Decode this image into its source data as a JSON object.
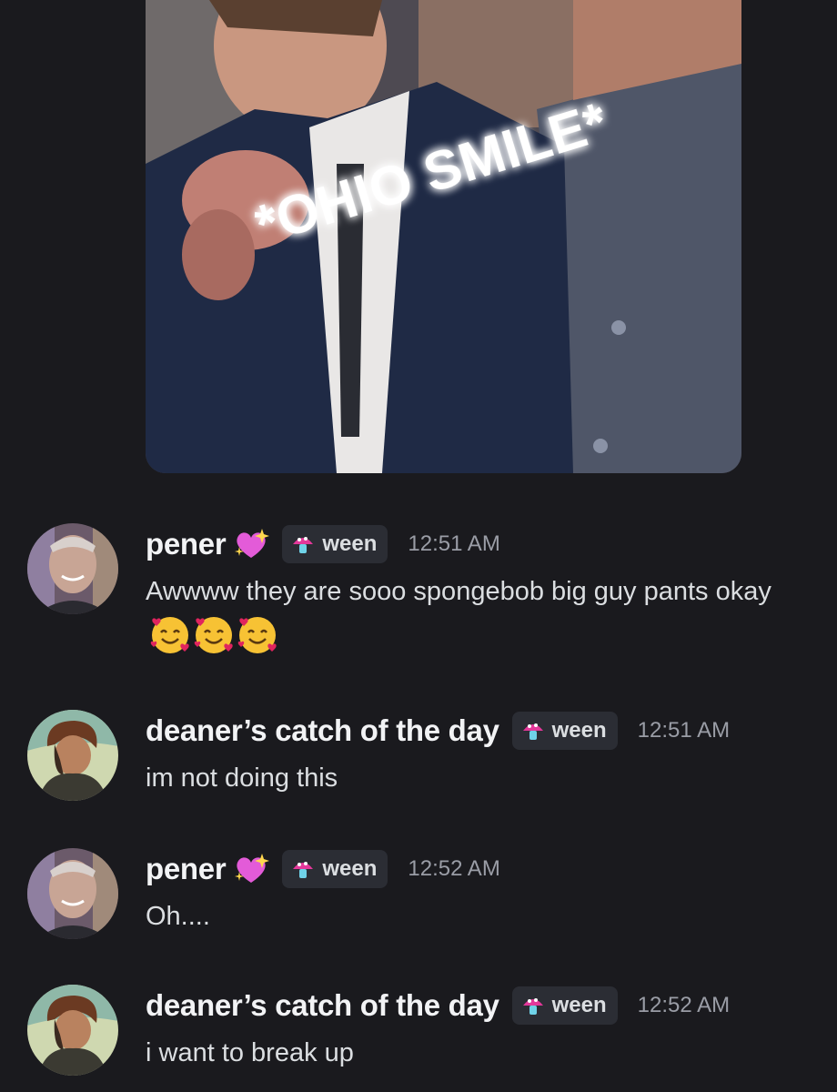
{
  "attachment": {
    "caption": "*OHIO SMILE*"
  },
  "messages": [
    {
      "username": "pener",
      "badge_icon": "sparkling-heart-icon",
      "tag_icon": "mushroom-icon",
      "tag": "ween",
      "time": "12:51 AM",
      "text": "Awwww they are sooo spongebob big guy pants okay",
      "reactions_inline": [
        "smiling-face-with-hearts",
        "smiling-face-with-hearts",
        "smiling-face-with-hearts"
      ]
    },
    {
      "username": "deaner’s catch of the day",
      "tag_icon": "mushroom-icon",
      "tag": "ween",
      "time": "12:51 AM",
      "text": "im not doing this"
    },
    {
      "username": "pener",
      "badge_icon": "sparkling-heart-icon",
      "tag_icon": "mushroom-icon",
      "tag": "ween",
      "time": "12:52 AM",
      "text": "Oh...."
    },
    {
      "username": "deaner’s catch of the day",
      "tag_icon": "mushroom-icon",
      "tag": "ween",
      "time": "12:52 AM",
      "text": "i want to break up"
    }
  ],
  "colors": {
    "background": "#1a1a1e",
    "username": "#f2f3f5",
    "text": "#dbdee1",
    "timestamp": "#9a9da6",
    "tag_bg": "#2b2d34",
    "heart": "#e35bd8"
  }
}
